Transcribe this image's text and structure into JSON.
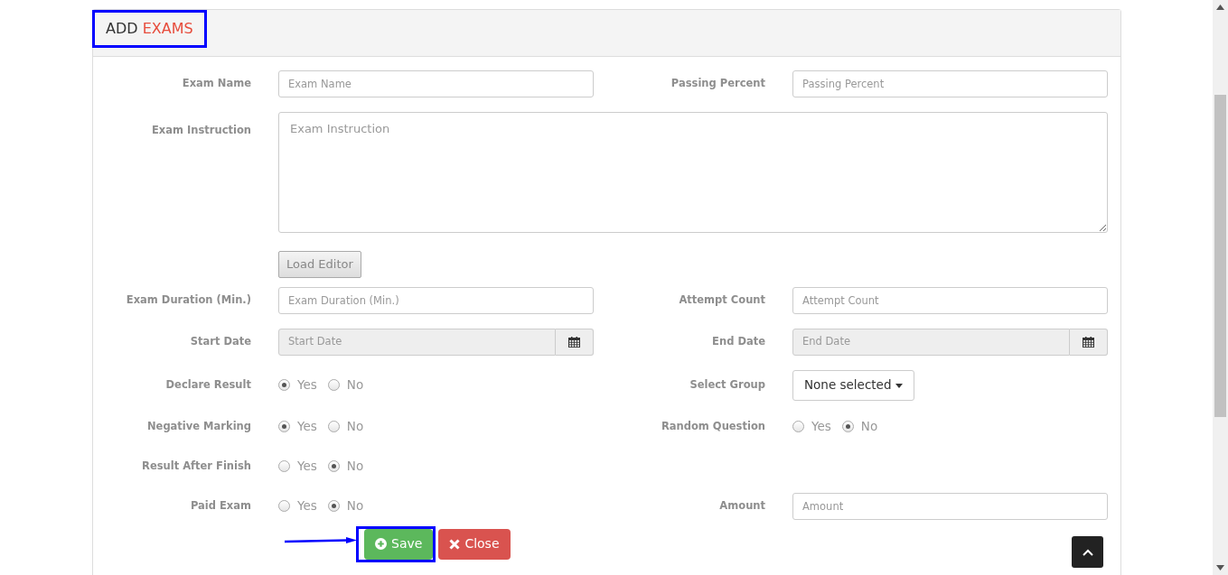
{
  "title": {
    "prefix": "ADD",
    "accent": "EXAMS"
  },
  "rows": [
    {
      "fields": [
        {
          "kind": "text",
          "label": "Exam Name",
          "placeholder": "Exam Name"
        },
        {
          "kind": "text",
          "label": "Passing Percent",
          "placeholder": "Passing Percent"
        }
      ]
    },
    {
      "fields": [
        {
          "kind": "textarea",
          "label": "Exam Instruction",
          "placeholder": "Exam Instruction"
        }
      ]
    },
    {
      "fields": [
        {
          "kind": "button",
          "text": "Load Editor"
        }
      ]
    },
    {
      "fields": [
        {
          "kind": "text",
          "label": "Exam Duration (Min.)",
          "placeholder": "Exam Duration (Min.)"
        },
        {
          "kind": "text",
          "label": "Attempt Count",
          "placeholder": "Attempt Count"
        }
      ]
    },
    {
      "fields": [
        {
          "kind": "date",
          "label": "Start Date",
          "placeholder": "Start Date"
        },
        {
          "kind": "date",
          "label": "End Date",
          "placeholder": "End Date"
        }
      ]
    },
    {
      "fields": [
        {
          "kind": "radio",
          "label": "Declare Result",
          "options": [
            {
              "label": "Yes",
              "selected": true
            },
            {
              "label": "No",
              "selected": false
            }
          ]
        },
        {
          "kind": "dropdown",
          "label": "Select Group",
          "value": "None selected"
        }
      ]
    },
    {
      "fields": [
        {
          "kind": "radio",
          "label": "Negative Marking",
          "options": [
            {
              "label": "Yes",
              "selected": true
            },
            {
              "label": "No",
              "selected": false
            }
          ]
        },
        {
          "kind": "radio",
          "label": "Random Question",
          "options": [
            {
              "label": "Yes",
              "selected": false
            },
            {
              "label": "No",
              "selected": true
            }
          ]
        }
      ]
    },
    {
      "fields": [
        {
          "kind": "radio",
          "label": "Result After Finish",
          "options": [
            {
              "label": "Yes",
              "selected": false
            },
            {
              "label": "No",
              "selected": true
            }
          ]
        }
      ]
    },
    {
      "fields": [
        {
          "kind": "radio",
          "label": "Paid Exam",
          "options": [
            {
              "label": "Yes",
              "selected": false
            },
            {
              "label": "No",
              "selected": true
            }
          ]
        },
        {
          "kind": "text",
          "label": "Amount",
          "placeholder": "Amount"
        }
      ]
    }
  ],
  "actions": [
    {
      "kind": "save",
      "label": "Save"
    },
    {
      "kind": "close",
      "label": "Close"
    }
  ]
}
